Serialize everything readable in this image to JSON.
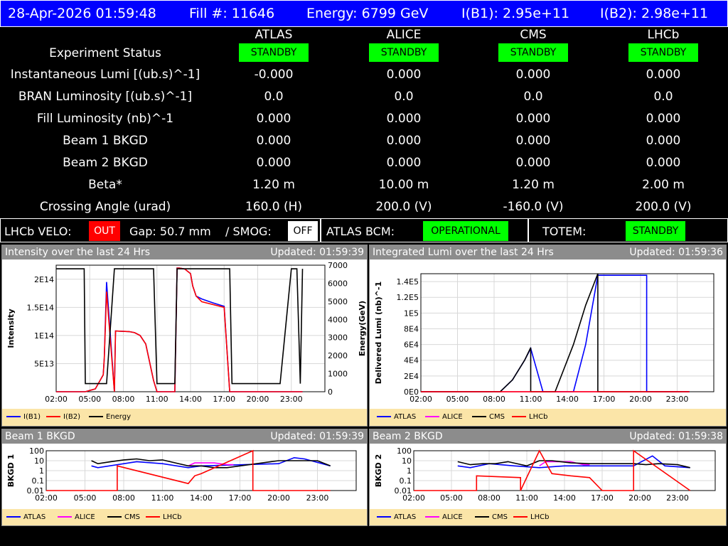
{
  "topbar": {
    "datetime": "28-Apr-2026 01:59:48",
    "fill": "Fill #: 11646",
    "energy": "Energy: 6799 GeV",
    "ib1": "I(B1): 2.95e+11",
    "ib2": "I(B2): 2.98e+11"
  },
  "experiments": [
    "ATLAS",
    "ALICE",
    "CMS",
    "LHCb"
  ],
  "status_rows": {
    "experiment_status": {
      "label": "Experiment Status",
      "values": [
        "STANDBY",
        "STANDBY",
        "STANDBY",
        "STANDBY"
      ]
    },
    "inst_lumi": {
      "label": "Instantaneous Lumi [(ub.s)^-1]",
      "values": [
        "-0.000",
        "0.000",
        "0.000",
        "0.000"
      ]
    },
    "bran_lumi": {
      "label": "BRAN Luminosity [(ub.s)^-1]",
      "values": [
        "0.0",
        "0.0",
        "0.0",
        "0.0"
      ]
    },
    "fill_lumi": {
      "label": "Fill Luminosity (nb)^-1",
      "values": [
        "0.000",
        "0.000",
        "0.000",
        "0.000"
      ]
    },
    "beam1_bkgd": {
      "label": "Beam 1 BKGD",
      "values": [
        "0.000",
        "0.000",
        "0.000",
        "0.000"
      ]
    },
    "beam2_bkgd": {
      "label": "Beam 2 BKGD",
      "values": [
        "0.000",
        "0.000",
        "0.000",
        "0.000"
      ]
    },
    "beta_star": {
      "label": "Beta*",
      "values": [
        "1.20 m",
        "10.00 m",
        "1.20 m",
        "2.00 m"
      ]
    },
    "crossing_angle": {
      "label": "Crossing Angle (urad)",
      "values": [
        "160.0 (H)",
        "200.0 (V)",
        "-160.0 (V)",
        "200.0 (V)"
      ]
    }
  },
  "midbar": {
    "velo_label": "LHCb VELO:",
    "velo_state": "OUT",
    "gap": "Gap: 50.7 mm",
    "smog_label": "/ SMOG:",
    "smog_state": "OFF",
    "bcm_label": "ATLAS BCM:",
    "bcm_state": "OPERATIONAL",
    "totem_label": "TOTEM:",
    "totem_state": "STANDBY"
  },
  "colors": {
    "header_bg": "#0000ff",
    "standby": "#00ff00",
    "out": "#ff0000",
    "b1": "#0000ff",
    "b2": "#ff0000",
    "energy": "#000000",
    "atlas": "#0000ff",
    "alice": "#ff00ff",
    "cms": "#000000",
    "lhcb": "#ff0000",
    "legend_bg": "#fbe5a8"
  },
  "panels": {
    "intensity": {
      "title": "Intensity over the last 24 Hrs",
      "updated": "Updated: 01:59:39",
      "legend": [
        "I(B1)",
        "I(B2)",
        "Energy"
      ]
    },
    "lumi": {
      "title": "Integrated Lumi over the last 24 Hrs",
      "updated": "Updated: 01:59:36",
      "legend": [
        "ATLAS",
        "ALICE",
        "CMS",
        "LHCb"
      ]
    },
    "bkgd1": {
      "title": "Beam 1 BKGD",
      "updated": "Updated: 01:59:39",
      "legend": [
        "ATLAS",
        "ALICE",
        "CMS",
        "LHCb"
      ]
    },
    "bkgd2": {
      "title": "Beam 2 BKGD",
      "updated": "Updated: 01:59:38",
      "legend": [
        "ATLAS",
        "ALICE",
        "CMS",
        "LHCb"
      ]
    }
  },
  "chart_data": [
    {
      "type": "line",
      "ylabel": "Intensity",
      "y2label": "Energy(GeV)",
      "x_ticks": [
        "02:00",
        "05:00",
        "08:00",
        "11:00",
        "14:00",
        "17:00",
        "20:00",
        "23:00"
      ],
      "y_ticks": [
        "5E13",
        "1E14",
        "1.5E14",
        "2E14"
      ],
      "y2_ticks": [
        "0",
        "1000",
        "2000",
        "3000",
        "4000",
        "5000",
        "6000",
        "7000"
      ],
      "ylim": [
        0,
        225000000000000.0
      ],
      "y2lim": [
        0,
        7000
      ],
      "x": [
        0,
        2.5,
        2.6,
        3.5,
        4.2,
        4.3,
        4.5,
        5.2,
        5.3,
        6.5,
        7.0,
        7.5,
        8.0,
        8.7,
        9.0,
        10.6,
        10.8,
        11.0,
        11.5,
        12.0,
        12.2,
        12.5,
        13.0,
        14.0,
        15.0,
        15.5,
        15.7,
        16.0,
        16.5,
        18.0,
        20.0,
        21.0,
        21.5,
        21.8,
        22.0
      ],
      "series": [
        {
          "name": "I(B1)",
          "values": [
            0,
            0,
            0,
            5000000000000.0,
            30000000000000.0,
            60000000000000.0,
            195000000000000.0,
            0,
            108000000000000.0,
            107000000000000.0,
            105000000000000.0,
            100000000000000.0,
            85000000000000.0,
            20000000000000.0,
            0,
            0,
            220000000000000.0,
            220000000000000.0,
            218000000000000.0,
            210000000000000.0,
            188000000000000.0,
            170000000000000.0,
            165000000000000.0,
            158000000000000.0,
            152000000000000.0,
            0,
            0,
            0,
            0,
            0,
            0,
            0,
            0,
            0,
            0
          ]
        },
        {
          "name": "I(B2)",
          "values": [
            0,
            0,
            0,
            5000000000000.0,
            30000000000000.0,
            60000000000000.0,
            178000000000000.0,
            0,
            108000000000000.0,
            107000000000000.0,
            105000000000000.0,
            100000000000000.0,
            85000000000000.0,
            20000000000000.0,
            0,
            0,
            220000000000000.0,
            220000000000000.0,
            218000000000000.0,
            210000000000000.0,
            188000000000000.0,
            170000000000000.0,
            160000000000000.0,
            155000000000000.0,
            150000000000000.0,
            0,
            0,
            0,
            0,
            0,
            0,
            0,
            0,
            0,
            0
          ]
        },
        {
          "name": "Energy",
          "values": [
            6800,
            6800,
            450,
            450,
            450,
            450,
            450,
            6800,
            6800,
            6800,
            6800,
            6800,
            6800,
            6800,
            450,
            450,
            6800,
            6800,
            6800,
            6800,
            6800,
            6800,
            6800,
            6800,
            6800,
            6800,
            450,
            450,
            450,
            450,
            450,
            6800,
            6800,
            450,
            6800
          ]
        }
      ]
    },
    {
      "type": "line",
      "ylabel": "Delivered Lumi (nb)^-1",
      "x_ticks": [
        "02:00",
        "05:00",
        "08:00",
        "11:00",
        "14:00",
        "17:00",
        "20:00",
        "23:00"
      ],
      "y_ticks": [
        "0E0",
        "2E4",
        "4E4",
        "6E4",
        "8E4",
        "1E5",
        "1.2E5",
        "1.4E5"
      ],
      "ylim": [
        0,
        150000
      ],
      "series": [
        {
          "name": "ATLAS",
          "x": [
            0,
            6.5,
            7.5,
            8.5,
            9.0,
            10.0,
            11.0,
            12.5,
            13.5,
            14.5,
            14.5,
            18.5,
            18.5,
            22.0
          ],
          "values": [
            0,
            0,
            15000,
            40000,
            55000,
            0,
            0,
            0,
            60000,
            148000,
            148000,
            148000,
            0,
            0
          ]
        },
        {
          "name": "ALICE",
          "x": [
            0,
            22.0
          ],
          "values": [
            0,
            0
          ]
        },
        {
          "name": "CMS",
          "x": [
            0,
            6.5,
            7.5,
            8.5,
            9.0,
            9.0,
            10.0,
            11.0,
            12.5,
            13.5,
            14.5,
            14.5,
            22.0
          ],
          "values": [
            0,
            0,
            15000,
            40000,
            56000,
            0,
            0,
            0,
            60000,
            110000,
            150000,
            0,
            0
          ]
        },
        {
          "name": "LHCb",
          "x": [
            0,
            22.0
          ],
          "values": [
            0,
            0
          ]
        }
      ]
    },
    {
      "type": "line",
      "ylabel": "BKGD 1",
      "x_ticks": [
        "02:00",
        "05:00",
        "08:00",
        "11:00",
        "14:00",
        "17:00",
        "20:00",
        "23:00"
      ],
      "y_ticks": [
        "0.01",
        "0.1",
        "1",
        "10",
        "100"
      ],
      "ylim": [
        0.01,
        100
      ],
      "scale": "log",
      "series": [
        {
          "name": "ATLAS",
          "x": [
            3.5,
            4.0,
            7.0,
            9.0,
            11.0,
            12.0,
            18.0,
            19.2,
            20.0,
            22.0
          ],
          "values": [
            3,
            2,
            8,
            5,
            2,
            3,
            5,
            20,
            15,
            3
          ]
        },
        {
          "name": "ALICE",
          "x": [
            11.0,
            11.5,
            12.0,
            13.0,
            14.0,
            14.5
          ],
          "values": [
            3,
            6,
            6,
            6,
            4,
            4
          ]
        },
        {
          "name": "CMS",
          "x": [
            3.5,
            4.0,
            5.0,
            6.0,
            7.0,
            8.0,
            9.0,
            11.0,
            12.0,
            13.0,
            14.0,
            18.0,
            19.0,
            20.0,
            21.0,
            22.0
          ],
          "values": [
            10,
            5,
            8,
            12,
            15,
            10,
            12,
            3,
            3,
            2,
            2,
            10,
            10,
            10,
            10,
            3
          ]
        },
        {
          "name": "LHCb",
          "x": [
            0,
            5.5,
            5.5,
            11.0,
            11.5,
            12.0,
            16.0,
            16.0,
            22.0
          ],
          "values": [
            0.01,
            0.01,
            3,
            0.05,
            0.3,
            0.5,
            100,
            0.01,
            0.01
          ]
        }
      ]
    },
    {
      "type": "line",
      "ylabel": "BKGD 2",
      "x_ticks": [
        "02:00",
        "05:00",
        "08:00",
        "11:00",
        "14:00",
        "17:00",
        "20:00",
        "23:00"
      ],
      "y_ticks": [
        "0.01",
        "0.1",
        "1",
        "10",
        "100"
      ],
      "ylim": [
        0.01,
        100
      ],
      "scale": "log",
      "series": [
        {
          "name": "ATLAS",
          "x": [
            3.5,
            4.5,
            6.0,
            8.0,
            10.0,
            12.0,
            17.5,
            19.0,
            20.0,
            22.0
          ],
          "values": [
            3,
            2,
            5,
            3,
            2,
            3,
            3,
            30,
            3,
            2
          ]
        },
        {
          "name": "ALICE",
          "x": [
            10.0,
            10.5,
            11.0,
            12.5,
            13.5,
            14.0
          ],
          "values": [
            3,
            8,
            8,
            8,
            4,
            4
          ]
        },
        {
          "name": "CMS",
          "x": [
            3.5,
            4.5,
            5.5,
            6.5,
            7.5,
            9.0,
            10.0,
            11.0,
            12.5,
            14.0,
            17.5,
            18.5,
            19.5,
            21.0,
            22.0
          ],
          "values": [
            8,
            4,
            5,
            5,
            8,
            3,
            10,
            10,
            6,
            5,
            5,
            4,
            5,
            4,
            2
          ]
        },
        {
          "name": "LHCb",
          "x": [
            0,
            5.0,
            5.0,
            8.5,
            8.5,
            10.0,
            11.0,
            12.5,
            14.0,
            15.0,
            15.0,
            17.5,
            17.5,
            22.0
          ],
          "values": [
            0.01,
            0.01,
            0.3,
            0.2,
            0.01,
            100,
            0.5,
            0.3,
            0.2,
            0.01,
            0.01,
            0.01,
            100,
            0.01
          ]
        }
      ]
    }
  ]
}
